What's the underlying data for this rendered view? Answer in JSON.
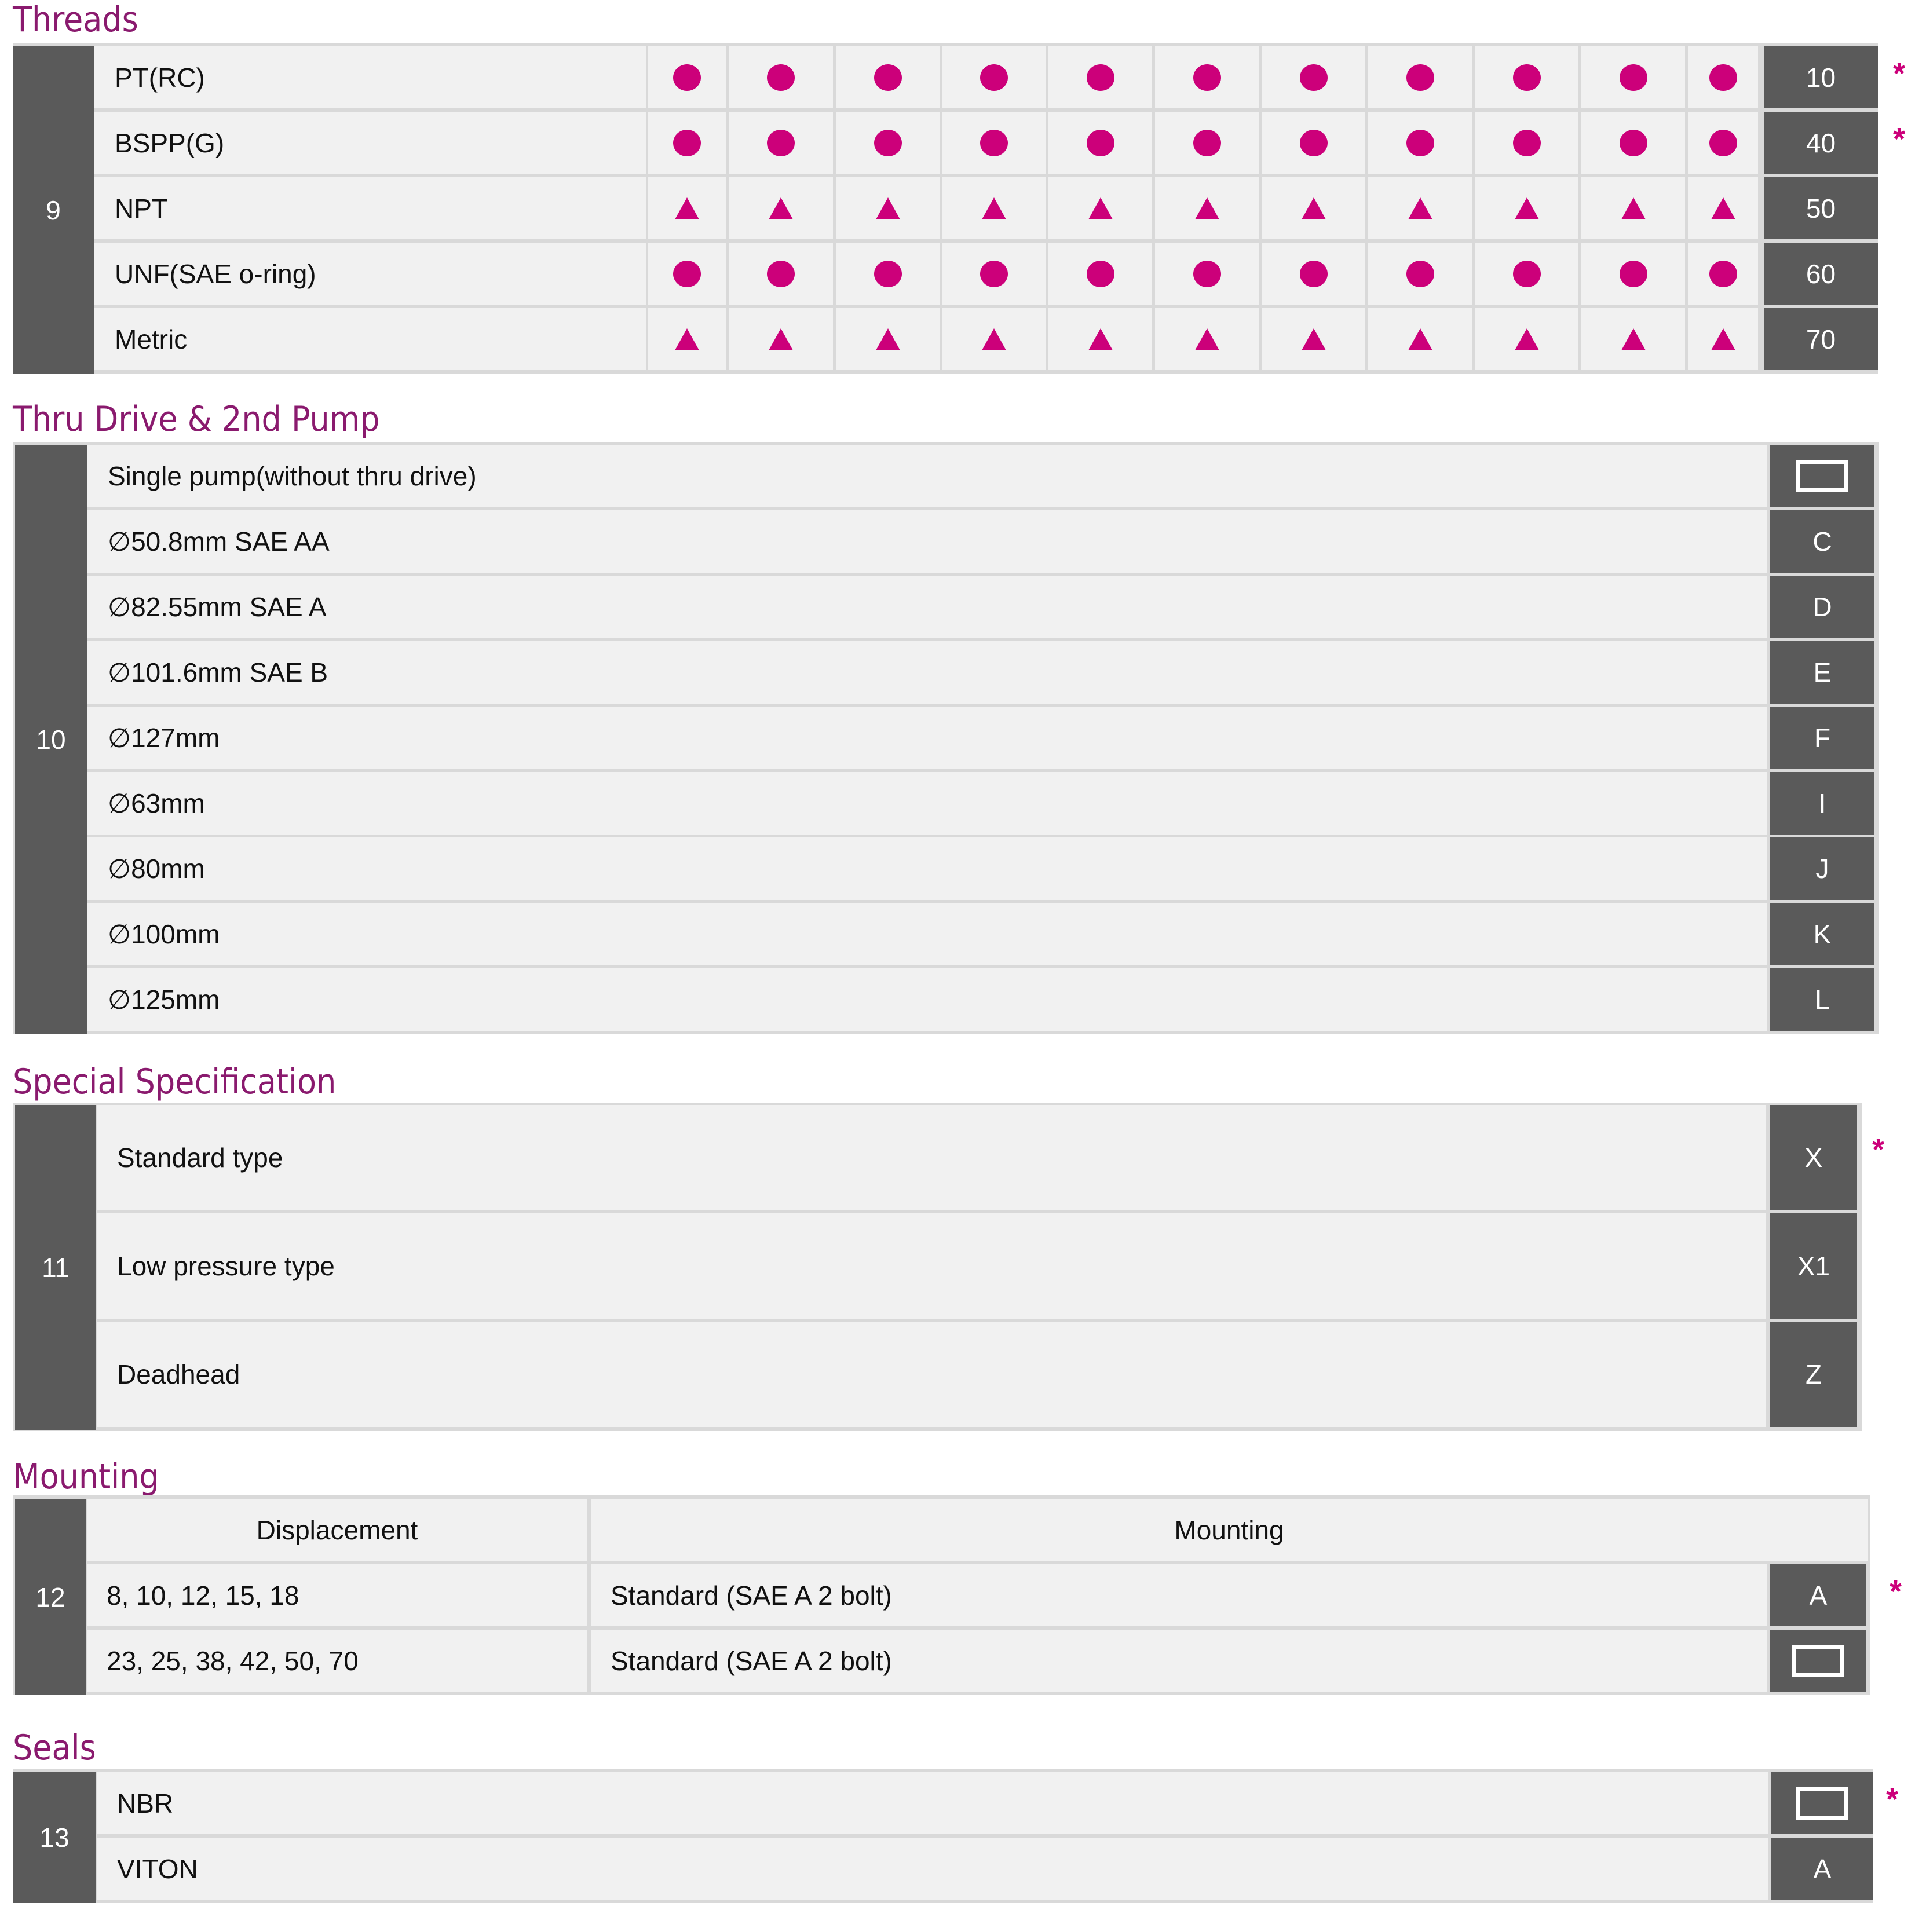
{
  "accent_color": "#cc007a",
  "title_color": "#8a1a6e",
  "threads": {
    "title": "Threads",
    "number": "9",
    "rows": [
      {
        "label": "PT(RC)",
        "marks": [
          "dot",
          "dot",
          "dot",
          "dot",
          "dot",
          "dot",
          "dot",
          "dot",
          "dot",
          "dot",
          "dot"
        ],
        "code": "10",
        "default": "*"
      },
      {
        "label": "BSPP(G)",
        "marks": [
          "dot",
          "dot",
          "dot",
          "dot",
          "dot",
          "dot",
          "dot",
          "dot",
          "dot",
          "dot",
          "dot"
        ],
        "code": "40",
        "default": "*"
      },
      {
        "label": "NPT",
        "marks": [
          "tri",
          "tri",
          "tri",
          "tri",
          "tri",
          "tri",
          "tri",
          "tri",
          "tri",
          "tri",
          "tri"
        ],
        "code": "50",
        "default": ""
      },
      {
        "label": "UNF(SAE o-ring)",
        "marks": [
          "dot",
          "dot",
          "dot",
          "dot",
          "dot",
          "dot",
          "dot",
          "dot",
          "dot",
          "dot",
          "dot"
        ],
        "code": "60",
        "default": ""
      },
      {
        "label": "Metric",
        "marks": [
          "tri",
          "tri",
          "tri",
          "tri",
          "tri",
          "tri",
          "tri",
          "tri",
          "tri",
          "tri",
          "tri"
        ],
        "code": "70",
        "default": ""
      }
    ]
  },
  "thru_drive": {
    "title": "Thru Drive & 2nd Pump",
    "number": "10",
    "rows": [
      {
        "label": "Single pump(without thru drive)",
        "code": "",
        "code_icon": "blank-box"
      },
      {
        "label": "∅50.8mm SAE AA",
        "code": "C"
      },
      {
        "label": "∅82.55mm SAE A",
        "code": "D"
      },
      {
        "label": "∅101.6mm SAE B",
        "code": "E"
      },
      {
        "label": "∅127mm",
        "code": "F"
      },
      {
        "label": "∅63mm",
        "code": "I"
      },
      {
        "label": "∅80mm",
        "code": "J"
      },
      {
        "label": "∅100mm",
        "code": "K"
      },
      {
        "label": "∅125mm",
        "code": "L"
      }
    ]
  },
  "special": {
    "title": "Special Specification",
    "number": "11",
    "rows": [
      {
        "label": "Standard type",
        "code": "X",
        "default": "*"
      },
      {
        "label": "Low pressure type",
        "code": "X1",
        "default": ""
      },
      {
        "label": "Deadhead",
        "code": "Z",
        "default": ""
      }
    ]
  },
  "mounting": {
    "title": "Mounting",
    "number": "12",
    "headers": [
      "Displacement",
      "Mounting"
    ],
    "rows": [
      {
        "displacement": "8, 10, 12, 15, 18",
        "mounting": "Standard (SAE A 2 bolt)",
        "code": "A",
        "default": "*"
      },
      {
        "displacement": "23, 25, 38, 42, 50, 70",
        "mounting": "Standard (SAE A 2 bolt)",
        "code": "",
        "code_icon": "blank-box",
        "default": ""
      }
    ]
  },
  "seals": {
    "title": "Seals",
    "number": "13",
    "rows": [
      {
        "label": "NBR",
        "code": "",
        "code_icon": "blank-box",
        "default": "*"
      },
      {
        "label": "VITON",
        "code": "A",
        "default": ""
      }
    ]
  }
}
